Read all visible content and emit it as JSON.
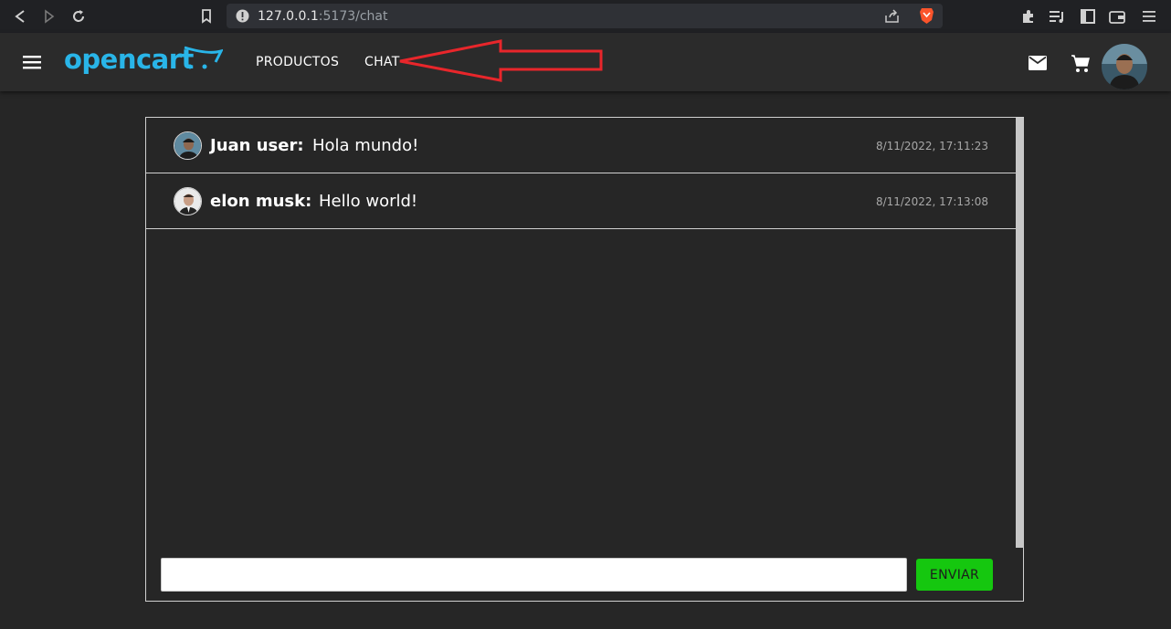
{
  "browser": {
    "url_host": "127.0.0.1",
    "url_path": ":5173/chat",
    "icons": [
      "back-icon",
      "forward-icon",
      "reload-icon",
      "bookmark-icon",
      "site-info-icon",
      "share-icon",
      "brave-shield-icon",
      "extensions-icon",
      "playlist-icon",
      "sidebar-icon",
      "wallet-icon",
      "menu-icon"
    ]
  },
  "header": {
    "logo": "opencart",
    "nav": [
      "PRODUCTOS",
      "CHAT"
    ],
    "icons": [
      "hamburger-icon",
      "mail-icon",
      "cart-icon",
      "user-avatar"
    ]
  },
  "messages": [
    {
      "author": "Juan user:",
      "text": "Hola mundo!",
      "time": "8/11/2022, 17:11:23"
    },
    {
      "author": "elon musk:",
      "text": "Hello world!",
      "time": "8/11/2022, 17:13:08"
    }
  ],
  "composer": {
    "value": "",
    "placeholder": "",
    "send_label": "ENVIAR"
  },
  "colors": {
    "accent": "#29b5e8",
    "send": "#15c70f",
    "annotation": "#e8262b",
    "background": "#262626"
  }
}
